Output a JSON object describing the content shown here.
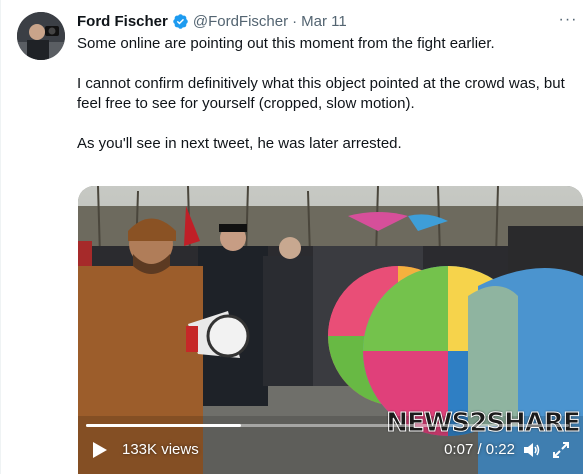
{
  "tweet": {
    "author_name": "Ford Fischer",
    "handle": "@FordFischer",
    "separator": "·",
    "date": "Mar 11",
    "paragraphs": [
      "Some online are pointing out this moment from the fight earlier.",
      "I cannot confirm definitively what this object pointed at the crowd was, but feel free to see for yourself (cropped, slow motion).",
      "As you'll see in next tweet, he was later arrested."
    ],
    "more_label": "···",
    "verified_icon": "verified-badge-icon"
  },
  "video": {
    "views": "133K views",
    "time": "0:07 / 0:22",
    "progress": 0.32,
    "watermark": "NEWS2SHARE",
    "icons": [
      "play-icon",
      "volume-icon",
      "fullscreen-icon"
    ]
  },
  "colors": {
    "verified_blue": "#1d9bf0",
    "text_primary": "#0f1419",
    "text_secondary": "#536471"
  }
}
